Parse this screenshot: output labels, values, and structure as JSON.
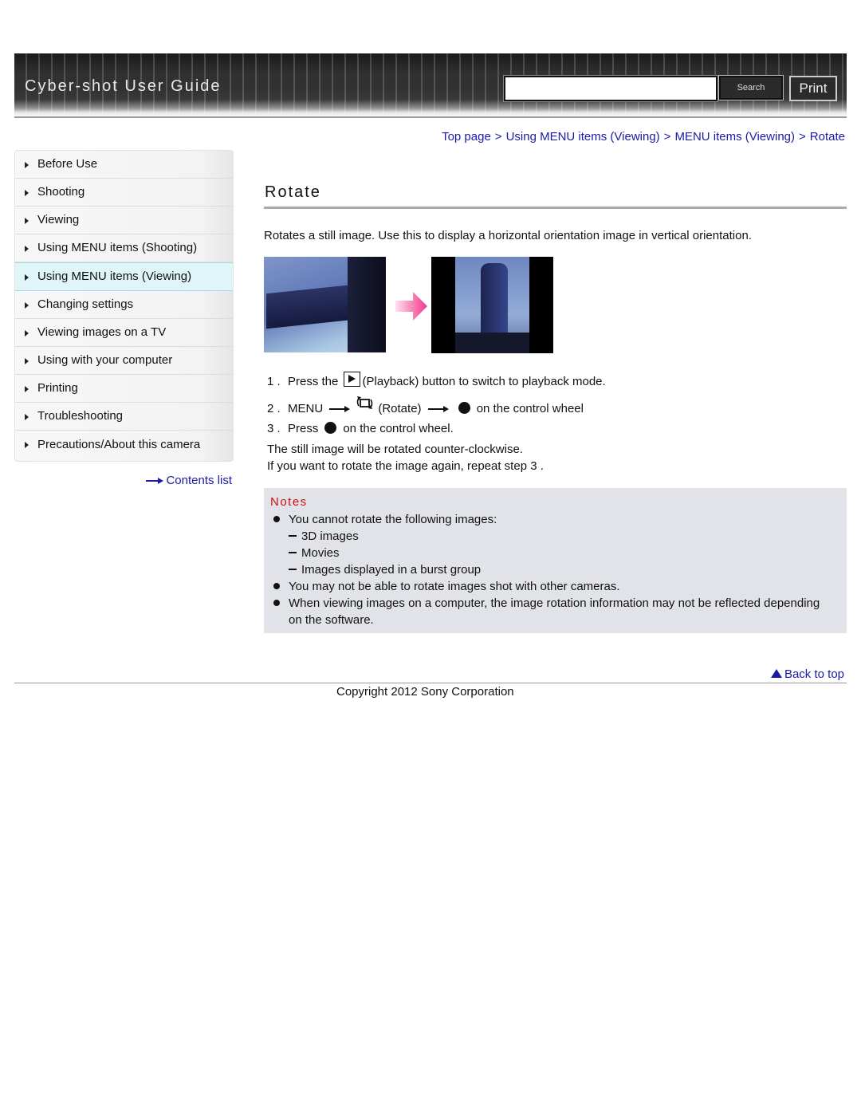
{
  "header": {
    "site_title": "Cyber-shot User Guide",
    "search_input_value": "",
    "search_placeholder": "",
    "search_button_label": "Search",
    "print_button_label": "Print"
  },
  "breadcrumb": {
    "items": [
      {
        "label": "Top page"
      },
      {
        "label": "Using MENU items (Viewing)"
      },
      {
        "label": "MENU items (Viewing)"
      },
      {
        "label": "Rotate"
      }
    ],
    "separator": ">"
  },
  "sidebar": {
    "items": [
      {
        "label": "Before Use"
      },
      {
        "label": "Shooting"
      },
      {
        "label": "Viewing"
      },
      {
        "label": "Using MENU items (Shooting)"
      },
      {
        "label": "Using MENU items (Viewing)",
        "active": true
      },
      {
        "label": "Changing settings"
      },
      {
        "label": "Viewing images on a TV"
      },
      {
        "label": "Using with your computer"
      },
      {
        "label": "Printing"
      },
      {
        "label": "Troubleshooting"
      },
      {
        "label": "Precautions/About this camera"
      }
    ],
    "contents_link": "Contents list"
  },
  "main": {
    "title": "Rotate",
    "intro": "Rotates a still image. Use this to display a horizontal orientation image in vertical orientation.",
    "images": {
      "before": "horizontal-building-photo",
      "arrow": "pink-arrow",
      "after": "rotated-building-photo"
    },
    "steps": [
      {
        "num": "1 .",
        "pre": "Press the",
        "icon": "playback-icon",
        "post": "(Playback) button to switch to playback mode."
      },
      {
        "num": "2 .",
        "menu": "MENU",
        "icon": "rotate-icon",
        "rotate_label": "(Rotate)",
        "post": "on the control wheel"
      },
      {
        "num": "3 .",
        "pre": "Press",
        "post": "on the control wheel.",
        "sub": [
          "The still image will be rotated counter-clockwise.",
          "If you want to rotate the image again, repeat step 3 ."
        ]
      }
    ]
  },
  "notes": {
    "title": "Notes",
    "items": [
      {
        "text": "You cannot rotate the following images:",
        "sub": [
          "3D images",
          "Movies",
          "Images displayed in a burst group"
        ]
      },
      {
        "text": "You may not be able to rotate images shot with other cameras."
      },
      {
        "text": "When viewing images on a computer, the image rotation information may not be reflected depending on the software."
      }
    ],
    "title_color": "#cc1111"
  },
  "footer": {
    "back_to_top": "Back to top",
    "copyright": "Copyright 2012 Sony Corporation"
  },
  "colors": {
    "link": "#1a1aa6",
    "active_sidebar_bg": "#dff5f8",
    "notes_bg": "#e1e3e8"
  }
}
